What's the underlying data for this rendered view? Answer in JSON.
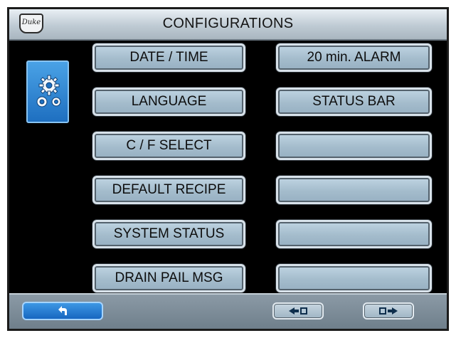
{
  "header": {
    "title": "CONFIGURATIONS",
    "logo_text": "Duke"
  },
  "left_buttons": [
    {
      "label": "DATE / TIME"
    },
    {
      "label": "LANGUAGE"
    },
    {
      "label": "C / F SELECT"
    },
    {
      "label": "DEFAULT RECIPE"
    },
    {
      "label": "SYSTEM STATUS"
    },
    {
      "label": "DRAIN PAIL MSG"
    }
  ],
  "right_buttons": [
    {
      "label": "20 min. ALARM"
    },
    {
      "label": "STATUS BAR"
    },
    {
      "label": ""
    },
    {
      "label": ""
    },
    {
      "label": ""
    },
    {
      "label": ""
    }
  ],
  "icons": {
    "section": "gears-icon",
    "back": "back-arrow-icon",
    "prev": "prev-page-icon",
    "next": "next-page-icon"
  }
}
